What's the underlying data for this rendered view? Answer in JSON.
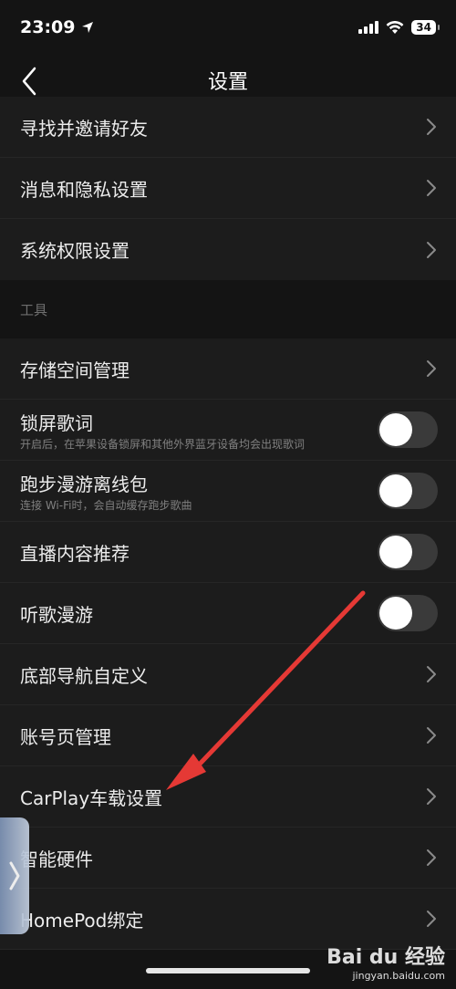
{
  "status": {
    "time": "23:09",
    "battery": "34"
  },
  "nav": {
    "title": "设置"
  },
  "rows_top": [
    {
      "label": "寻找并邀请好友"
    },
    {
      "label": "消息和隐私设置"
    },
    {
      "label": "系统权限设置"
    }
  ],
  "section": {
    "tools": "工具"
  },
  "rows_tools": [
    {
      "label": "存储空间管理",
      "type": "chevron"
    },
    {
      "label": "锁屏歌词",
      "sub": "开启后，在苹果设备锁屏和其他外界蓝牙设备均会出现歌词",
      "type": "toggle",
      "on": false
    },
    {
      "label": "跑步漫游离线包",
      "sub": "连接 Wi-Fi时，会自动缓存跑步歌曲",
      "type": "toggle",
      "on": false
    },
    {
      "label": "直播内容推荐",
      "type": "toggle",
      "on": false
    },
    {
      "label": "听歌漫游",
      "type": "toggle",
      "on": false
    },
    {
      "label": "底部导航自定义",
      "type": "chevron"
    },
    {
      "label": "账号页管理",
      "type": "chevron"
    },
    {
      "label": "CarPlay车载设置",
      "type": "chevron"
    },
    {
      "label": "智能硬件",
      "type": "chevron"
    },
    {
      "label": "HomePod绑定",
      "type": "chevron"
    }
  ],
  "watermark": {
    "logo": "Bai du 经验",
    "url": "jingyan.baidu.com"
  },
  "colors": {
    "background": "#141414",
    "row": "#1c1c1c",
    "annotation_arrow": "#e53935"
  }
}
